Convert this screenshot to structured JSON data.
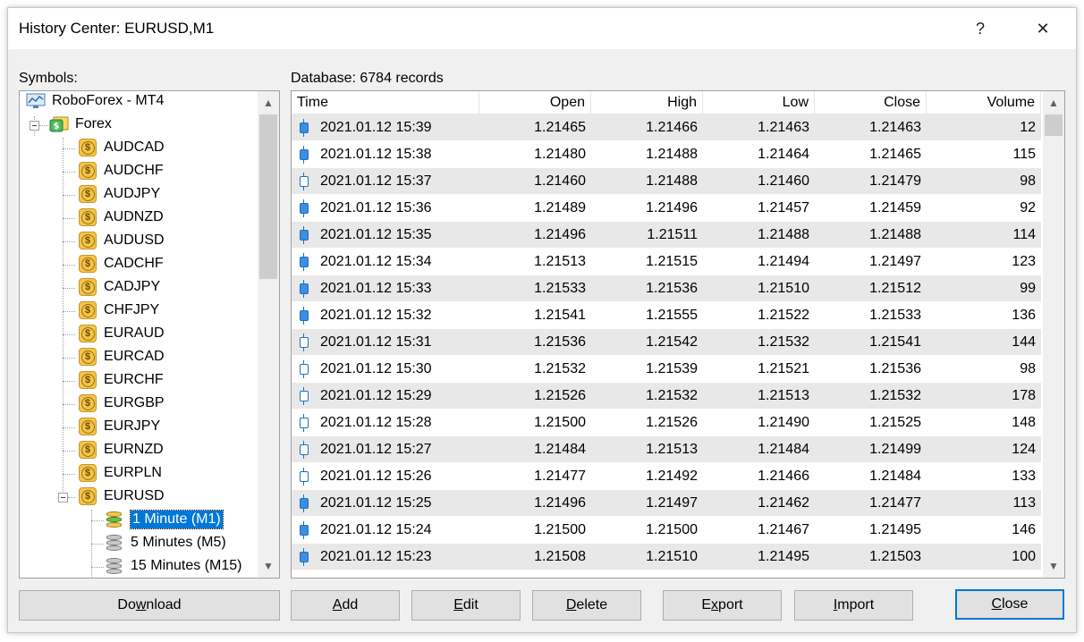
{
  "window": {
    "title": "History Center: EURUSD,M1",
    "help_label": "?",
    "close_label": "✕"
  },
  "symbols_label": "Symbols:",
  "database_label": "Database: 6784 records",
  "tree": {
    "root": "RoboForex - MT4",
    "group": "Forex",
    "symbols": [
      "AUDCAD",
      "AUDCHF",
      "AUDJPY",
      "AUDNZD",
      "AUDUSD",
      "CADCHF",
      "CADJPY",
      "CHFJPY",
      "EURAUD",
      "EURCAD",
      "EURCHF",
      "EURGBP",
      "EURJPY",
      "EURNZD",
      "EURPLN",
      "EURUSD"
    ],
    "timeframes": [
      "1 Minute (M1)",
      "5 Minutes (M5)",
      "15 Minutes (M15)"
    ],
    "selected_timeframe": "1 Minute (M1)",
    "coin_glyph": "$"
  },
  "table": {
    "columns": [
      "Time",
      "Open",
      "High",
      "Low",
      "Close",
      "Volume"
    ],
    "rows": [
      {
        "time": "2021.01.12 15:39",
        "open": "1.21465",
        "high": "1.21466",
        "low": "1.21463",
        "close": "1.21463",
        "volume": "12",
        "bear": true
      },
      {
        "time": "2021.01.12 15:38",
        "open": "1.21480",
        "high": "1.21488",
        "low": "1.21464",
        "close": "1.21465",
        "volume": "115",
        "bear": true
      },
      {
        "time": "2021.01.12 15:37",
        "open": "1.21460",
        "high": "1.21488",
        "low": "1.21460",
        "close": "1.21479",
        "volume": "98",
        "bear": false
      },
      {
        "time": "2021.01.12 15:36",
        "open": "1.21489",
        "high": "1.21496",
        "low": "1.21457",
        "close": "1.21459",
        "volume": "92",
        "bear": true
      },
      {
        "time": "2021.01.12 15:35",
        "open": "1.21496",
        "high": "1.21511",
        "low": "1.21488",
        "close": "1.21488",
        "volume": "114",
        "bear": true
      },
      {
        "time": "2021.01.12 15:34",
        "open": "1.21513",
        "high": "1.21515",
        "low": "1.21494",
        "close": "1.21497",
        "volume": "123",
        "bear": true
      },
      {
        "time": "2021.01.12 15:33",
        "open": "1.21533",
        "high": "1.21536",
        "low": "1.21510",
        "close": "1.21512",
        "volume": "99",
        "bear": true
      },
      {
        "time": "2021.01.12 15:32",
        "open": "1.21541",
        "high": "1.21555",
        "low": "1.21522",
        "close": "1.21533",
        "volume": "136",
        "bear": true
      },
      {
        "time": "2021.01.12 15:31",
        "open": "1.21536",
        "high": "1.21542",
        "low": "1.21532",
        "close": "1.21541",
        "volume": "144",
        "bear": false
      },
      {
        "time": "2021.01.12 15:30",
        "open": "1.21532",
        "high": "1.21539",
        "low": "1.21521",
        "close": "1.21536",
        "volume": "98",
        "bear": false
      },
      {
        "time": "2021.01.12 15:29",
        "open": "1.21526",
        "high": "1.21532",
        "low": "1.21513",
        "close": "1.21532",
        "volume": "178",
        "bear": false
      },
      {
        "time": "2021.01.12 15:28",
        "open": "1.21500",
        "high": "1.21526",
        "low": "1.21490",
        "close": "1.21525",
        "volume": "148",
        "bear": false
      },
      {
        "time": "2021.01.12 15:27",
        "open": "1.21484",
        "high": "1.21513",
        "low": "1.21484",
        "close": "1.21499",
        "volume": "124",
        "bear": false
      },
      {
        "time": "2021.01.12 15:26",
        "open": "1.21477",
        "high": "1.21492",
        "low": "1.21466",
        "close": "1.21484",
        "volume": "133",
        "bear": false
      },
      {
        "time": "2021.01.12 15:25",
        "open": "1.21496",
        "high": "1.21497",
        "low": "1.21462",
        "close": "1.21477",
        "volume": "113",
        "bear": true
      },
      {
        "time": "2021.01.12 15:24",
        "open": "1.21500",
        "high": "1.21500",
        "low": "1.21467",
        "close": "1.21495",
        "volume": "146",
        "bear": true
      },
      {
        "time": "2021.01.12 15:23",
        "open": "1.21508",
        "high": "1.21510",
        "low": "1.21495",
        "close": "1.21503",
        "volume": "100",
        "bear": true
      }
    ]
  },
  "buttons": {
    "download": {
      "pre": "Do",
      "key": "w",
      "post": "nload"
    },
    "add": {
      "pre": "",
      "key": "A",
      "post": "dd"
    },
    "edit": {
      "pre": "",
      "key": "E",
      "post": "dit"
    },
    "delete": {
      "pre": "",
      "key": "D",
      "post": "elete"
    },
    "export": {
      "pre": "E",
      "key": "x",
      "post": "port"
    },
    "import": {
      "pre": "",
      "key": "I",
      "post": "mport"
    },
    "close": {
      "pre": "",
      "key": "C",
      "post": "lose"
    }
  },
  "scroll_arrows": {
    "up": "▲",
    "down": "▼"
  },
  "colors": {
    "selection": "#0078d7",
    "bear_candle": "#3b8ee0",
    "candle_outline": "#1f6fbf",
    "alt_row": "#e8e8e8"
  }
}
